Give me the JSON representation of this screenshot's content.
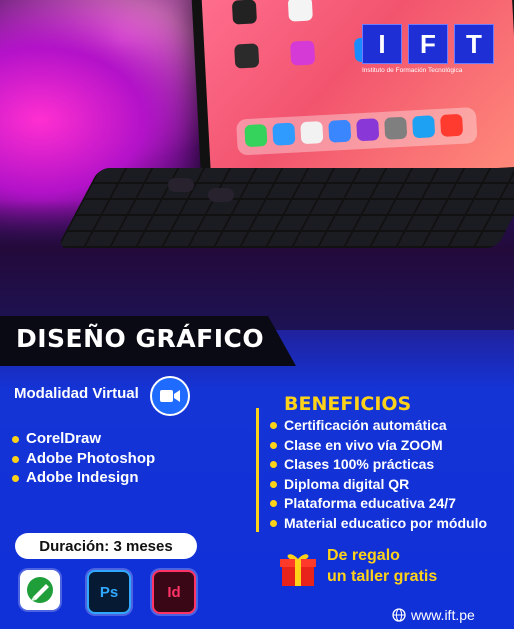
{
  "logo": {
    "letters": [
      "I",
      "F",
      "T"
    ],
    "tagline": "Instituto de Formación Tecnológica"
  },
  "title": "DISEÑO GRÁFICO",
  "modalidad": "Modalidad Virtual",
  "software": [
    "CorelDraw",
    "Adobe Photoshop",
    "Adobe Indesign"
  ],
  "beneficios": {
    "title": "BENEFICIOS",
    "items": [
      "Certificación automática",
      "Clase en vivo vía ZOOM",
      "Clases 100% prácticas",
      "Diploma digital QR",
      "Plataforma educativa 24/7",
      "Material educatico por módulo"
    ]
  },
  "duracion": "Duración: 3 meses",
  "app_icons": {
    "photoshop": "Ps",
    "indesign": "Id"
  },
  "regalo": {
    "line1": "De regalo",
    "line2": "un taller gratis"
  },
  "website": "www.ift.pe",
  "colors": {
    "accent_yellow": "#ffd21a",
    "brand_blue": "#1f2fd6",
    "zoom_blue": "#1f6bff"
  },
  "icons": [
    "video-camera-icon",
    "coreldraw-icon",
    "photoshop-icon",
    "indesign-icon",
    "gift-icon",
    "globe-icon"
  ]
}
